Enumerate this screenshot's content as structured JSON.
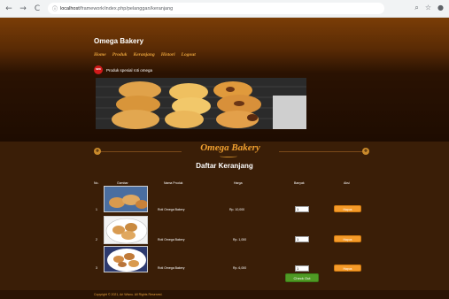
{
  "browser": {
    "back": "←",
    "forward": "→",
    "reload": "C",
    "lock": "ⓘ",
    "url_host": "localhost",
    "url_path": "/framework/index.php/pelanggan/keranjang",
    "icons": [
      "search-icon",
      "star-icon",
      "profile-icon"
    ]
  },
  "site": {
    "title": "Omega Bakery",
    "menu": [
      "Home",
      "Produk",
      "Keranjang",
      "Histori",
      "Logout"
    ],
    "badge": "NEW",
    "promo": "Produk spesial roti omega",
    "brand_logo": "Omega Bakery",
    "colors": {
      "accent": "#f0a030",
      "bg_dark": "#3a1e07",
      "button_orange": "#f59b2a",
      "button_green": "#4f9a24"
    }
  },
  "cart": {
    "title": "Daftar Keranjang",
    "headers": [
      "No.",
      "Gambar",
      "Nama Produk",
      "Harga",
      "Banyak",
      "Aksi"
    ],
    "rows": [
      {
        "no": "1",
        "name": "Roti Omega Bakery",
        "price": "Rp. 10,000",
        "qty": "1",
        "action": "Hapus"
      },
      {
        "no": "2",
        "name": "Roti Omega Bakery",
        "price": "Rp. 1,000",
        "qty": "1",
        "action": "Hapus"
      },
      {
        "no": "3",
        "name": "Roti Omega Bakery",
        "price": "Rp. 6,000",
        "qty": "1",
        "action": "Hapus"
      }
    ],
    "checkout": "Check Out"
  },
  "footer": {
    "copyright": "Copyright © 2021, Ari Wisnu. All Rights Reserved."
  }
}
